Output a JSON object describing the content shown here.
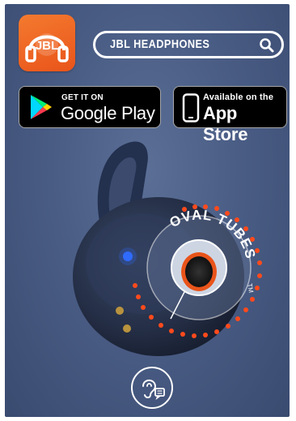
{
  "search": {
    "value": "JBL HEADPHONES"
  },
  "logo": {
    "text": "JBL"
  },
  "badges": {
    "google_play": {
      "top_line": "GET IT ON",
      "main_line": "Google Play"
    },
    "app_store": {
      "top_line": "Available on the",
      "main_line": "App Store"
    }
  },
  "product": {
    "label": "OVAL TUBES",
    "mark": "TM"
  },
  "colors": {
    "accent": "#e9541a",
    "background": "#4a5d85",
    "dots": "#ff4a1c"
  }
}
